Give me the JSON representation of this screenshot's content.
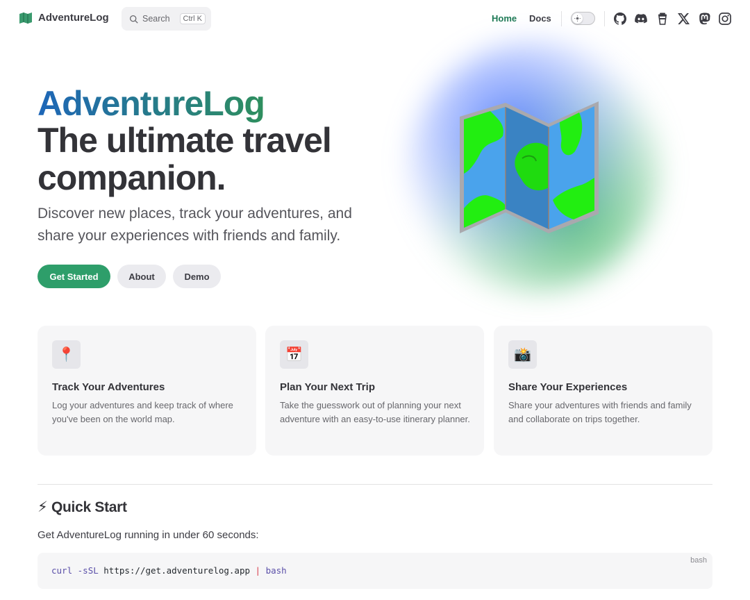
{
  "nav": {
    "brand": "AdventureLog",
    "search_label": "Search",
    "search_shortcut": "Ctrl K",
    "links": [
      {
        "label": "Home",
        "active": true
      },
      {
        "label": "Docs",
        "active": false
      }
    ],
    "theme": "light",
    "social_icons": [
      "github-icon",
      "discord-icon",
      "buymeacoffee-icon",
      "x-icon",
      "mastodon-icon",
      "instagram-icon"
    ]
  },
  "hero": {
    "name": "AdventureLog",
    "text": "The ultimate travel companion.",
    "tagline": "Discover new places, track your adventures, and share your experiences with friends and family.",
    "actions": [
      {
        "label": "Get Started",
        "style": "primary"
      },
      {
        "label": "About",
        "style": "alt"
      },
      {
        "label": "Demo",
        "style": "alt"
      }
    ],
    "image": "folded-map-icon"
  },
  "features": [
    {
      "icon": "📍",
      "icon_name": "pin-icon",
      "title": "Track Your Adventures",
      "details": "Log your adventures and keep track of where you've been on the world map."
    },
    {
      "icon": "📅",
      "icon_name": "calendar-icon",
      "title": "Plan Your Next Trip",
      "details": "Take the guesswork out of planning your next adventure with an easy-to-use itinerary planner."
    },
    {
      "icon": "📸",
      "icon_name": "camera-icon",
      "title": "Share Your Experiences",
      "details": "Share your adventures with friends and family and collaborate on trips together."
    }
  ],
  "quick_start": {
    "title": "⚡ Quick Start",
    "subtitle": "Get AdventureLog running in under 60 seconds:",
    "code_lang": "bash",
    "code": {
      "cmd": "curl",
      "flag": "-sSL",
      "url": "https://get.adventurelog.app",
      "pipe": "|",
      "shell": "bash"
    }
  },
  "colors": {
    "brand": "#2e9e6a",
    "gradient_start": "#1e66b8",
    "gradient_end": "#2e8f5e"
  }
}
